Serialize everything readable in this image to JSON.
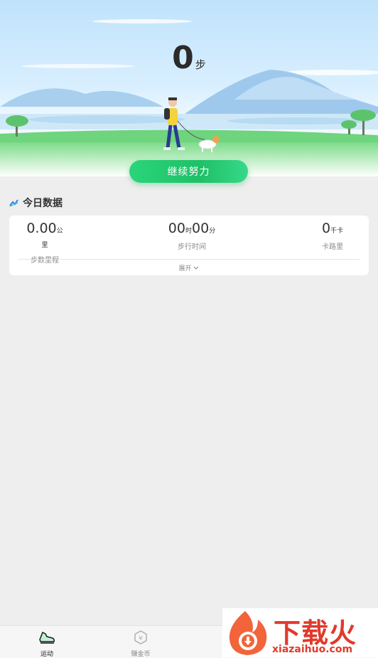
{
  "hero": {
    "steps_value": "0",
    "steps_unit": "步",
    "cta_label": "继续努力"
  },
  "today": {
    "title": "今日数据",
    "stats": [
      {
        "value": "0.00",
        "unit": "公里",
        "label": "步数里程"
      },
      {
        "value_h": "00",
        "unit_h": "时",
        "value_m": "00",
        "unit_m": "分",
        "label": "步行时间"
      },
      {
        "value": "0",
        "unit": "千卡",
        "label": "卡路里"
      }
    ],
    "expand_label": "展开"
  },
  "tabs": [
    {
      "label": "运动",
      "icon": "shoe-icon",
      "active": true
    },
    {
      "label": "赚金币",
      "icon": "coin-icon",
      "active": false
    }
  ],
  "watermark": {
    "text": "下载火",
    "url": "xiazaihuo.com"
  },
  "colors": {
    "accent": "#1fc067",
    "text": "#333333",
    "muted": "#8a8a8a"
  }
}
